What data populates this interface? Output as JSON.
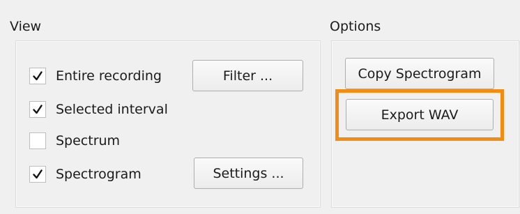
{
  "view": {
    "title": "View",
    "checkboxes": [
      {
        "label": "Entire recording",
        "checked": true
      },
      {
        "label": "Selected interval",
        "checked": true
      },
      {
        "label": "Spectrum",
        "checked": false
      },
      {
        "label": "Spectrogram",
        "checked": true
      }
    ],
    "filter_button": "Filter ...",
    "settings_button": "Settings ..."
  },
  "options": {
    "title": "Options",
    "copy_spectrogram_button": "Copy Spectrogram",
    "export_wav_button": "Export WAV"
  },
  "colors": {
    "highlight": "#f28c12",
    "background": "#f0f0f0"
  },
  "icons": {
    "check": "check-icon"
  }
}
